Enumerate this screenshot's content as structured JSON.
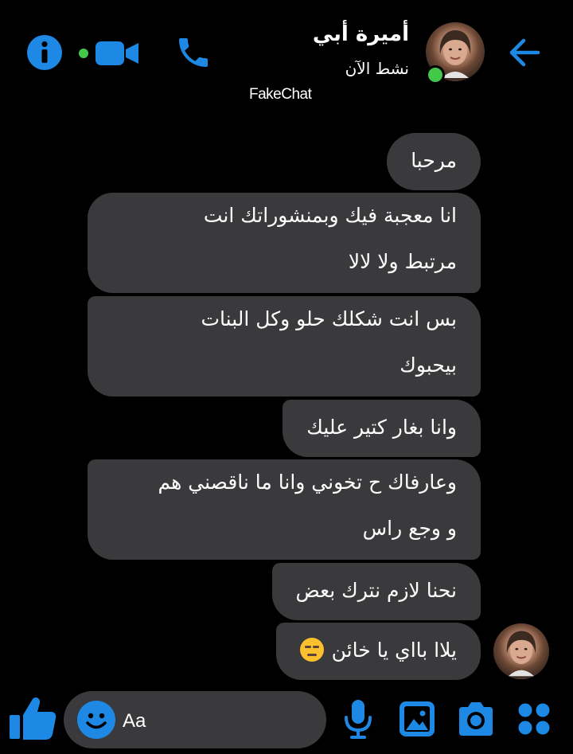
{
  "accent_color": "#1e88e5",
  "status_color": "#43c84a",
  "header": {
    "contact_name": "أميرة أبي",
    "status": "نشط الآن",
    "watermark": "FakeChat",
    "icons": [
      "info-icon",
      "video-call-icon",
      "phone-icon",
      "back-arrow-icon"
    ]
  },
  "messages": [
    {
      "lines": [
        "مرحبا"
      ]
    },
    {
      "lines": [
        "انا معجبة فيك وبمنشوراتك انت",
        "مرتبط ولا لالا"
      ]
    },
    {
      "lines": [
        "بس انت شكلك حلو وكل البنات",
        "بيحبوك"
      ]
    },
    {
      "lines": [
        "وانا بغار كتير عليك"
      ]
    },
    {
      "lines": [
        "وعارفاك ح تخوني وانا ما ناقصني هم",
        "و وجع راس"
      ]
    },
    {
      "lines": [
        "نحنا لازم نترك بعض"
      ]
    },
    {
      "lines": [
        "يلاا بااي يا خائن"
      ],
      "emoji": "unamused-face-emoji"
    }
  ],
  "composer": {
    "placeholder": "Aa",
    "icons": [
      "like-icon",
      "emoji-icon",
      "microphone-icon",
      "gallery-icon",
      "camera-icon",
      "more-apps-icon"
    ]
  }
}
